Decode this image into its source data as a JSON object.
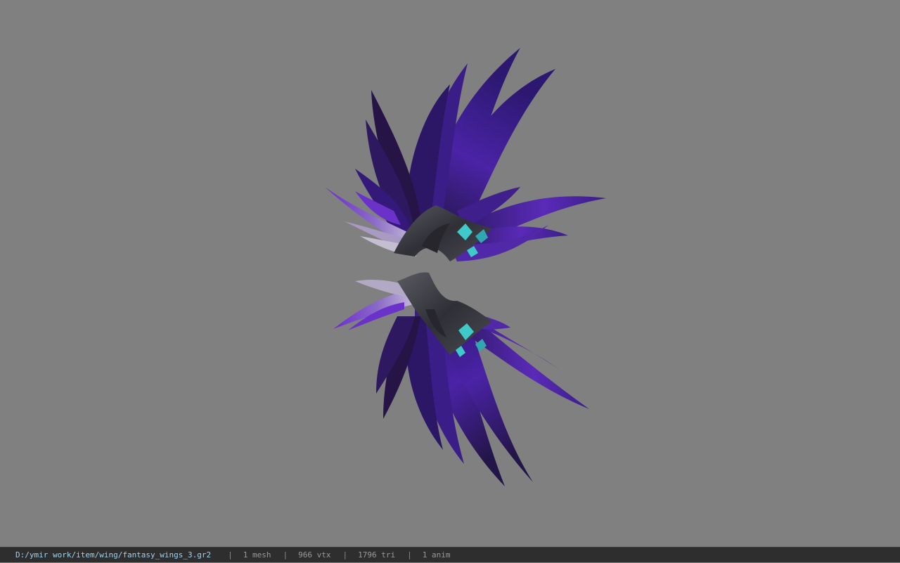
{
  "viewport": {
    "background_color": "#808080",
    "model": {
      "description_icon": "purple-feather-wings-model",
      "feather_colors": [
        "#2a1a5c",
        "#3b1f86",
        "#5a2ab8",
        "#6c3ad0",
        "#b8b2c8"
      ],
      "metal_color": "#3a3a40",
      "gem_color": "#3fc9c9"
    }
  },
  "statusbar": {
    "path": "D:/ymir work/item/wing/fantasy_wings_3.gr2",
    "separator": "|",
    "mesh": "1 mesh",
    "vtx": "966 vtx",
    "tri": "1796 tri",
    "anim": "1 anim",
    "background_color": "#2e2e2e",
    "path_color": "#9fd3ee"
  }
}
